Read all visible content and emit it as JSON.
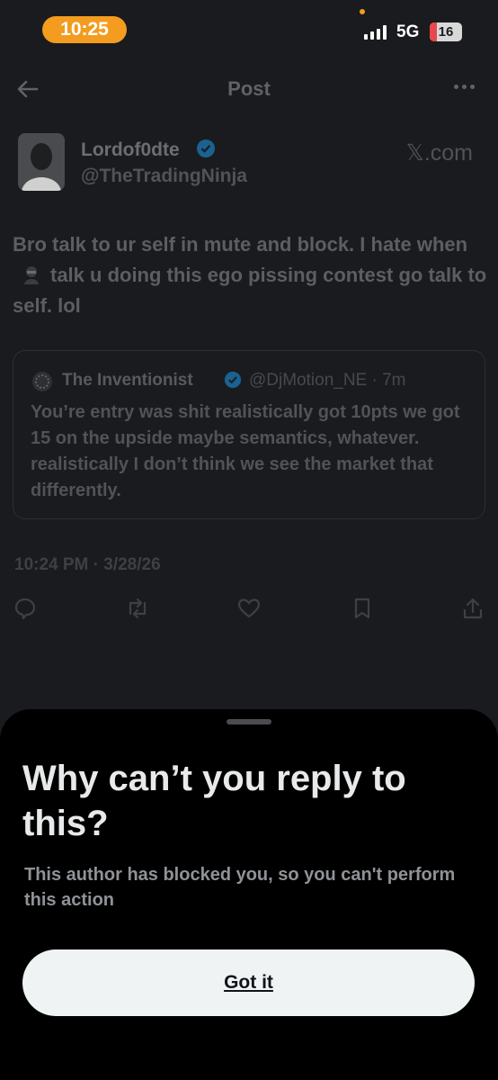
{
  "status_bar": {
    "time": "10:25",
    "network": "5G",
    "battery": "16"
  },
  "header": {
    "title": "Post",
    "back_icon": "arrow-left-icon",
    "more_icon": "more-dots-icon"
  },
  "post": {
    "author_name": "Lordof0dte",
    "author_handle": "@TheTradingNinja",
    "source": "𝕏.com",
    "text_part1": "Bro talk to ur self in mute and block.  I hate when",
    "text_part2": "talk u doing this ego pissing contest go talk to self. lol",
    "timestamp": "10:24 PM · 3/28/26",
    "quote": {
      "author_name": "The Inventionist",
      "author_handle": "@DjMotion_NE · 7m",
      "text": "You’re entry was shit realistically got 10pts we got 15 on the upside maybe semantics, whatever. realistically I don’t think we see the market that differently."
    },
    "actions": [
      "reply-icon",
      "repost-icon",
      "like-icon",
      "bookmark-icon",
      "share-icon"
    ]
  },
  "sheet": {
    "title": "Why can’t you reply to this?",
    "message": "This author has blocked you, so you can't perform this action",
    "button_label": "Got it"
  },
  "colors": {
    "accent_orange": "#f39c1f",
    "verified_blue": "#1d9bf0",
    "sheet_bg": "#000000"
  }
}
